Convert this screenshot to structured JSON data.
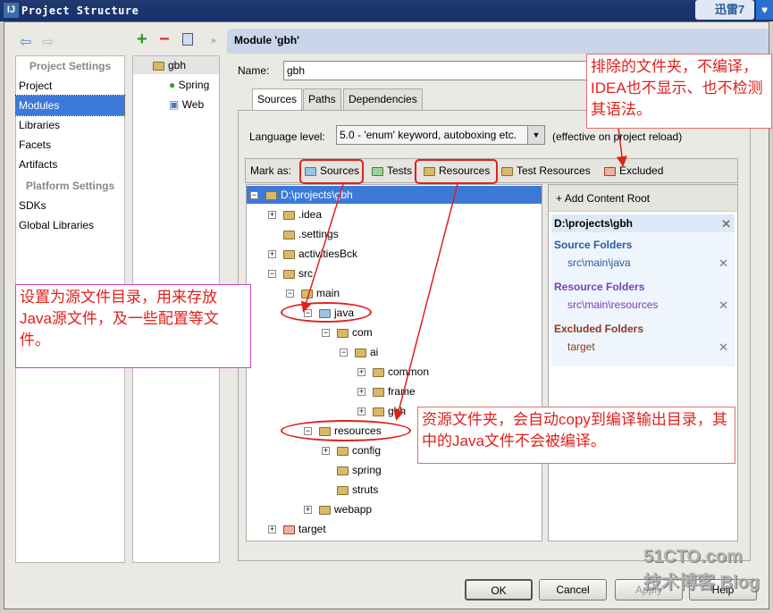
{
  "window": {
    "title": "Project Structure",
    "logo": "IJ",
    "overlay_app": "迅雷7"
  },
  "nav": {
    "project_settings_header": "Project Settings",
    "platform_settings_header": "Platform Settings",
    "items": [
      "Project",
      "Modules",
      "Libraries",
      "Facets",
      "Artifacts"
    ],
    "platform_items": [
      "SDKs",
      "Global Libraries"
    ],
    "selected": "Modules"
  },
  "module_tree": {
    "root": "gbh",
    "children": [
      "Spring",
      "Web"
    ]
  },
  "header": {
    "title": "Module 'gbh'"
  },
  "name_field": {
    "label": "Name:",
    "value": "gbh"
  },
  "tabs": [
    "Sources",
    "Paths",
    "Dependencies"
  ],
  "language": {
    "label": "Language level:",
    "value": "5.0 - 'enum' keyword, autoboxing etc.",
    "note": "(effective on project reload)"
  },
  "mark_as": {
    "label": "Mark as:",
    "items": [
      "Sources",
      "Tests",
      "Resources",
      "Test Resources",
      "Excluded"
    ]
  },
  "tree": [
    {
      "label": "D:\\projects\\gbh",
      "level": 0,
      "exp": "-",
      "sel": true
    },
    {
      "label": ".idea",
      "level": 1,
      "exp": "+"
    },
    {
      "label": ".settings",
      "level": 1
    },
    {
      "label": "activitiesBck",
      "level": 1,
      "exp": "+"
    },
    {
      "label": "src",
      "level": 1,
      "exp": "-"
    },
    {
      "label": "main",
      "level": 2,
      "exp": "-"
    },
    {
      "label": "java",
      "level": 3,
      "exp": "-",
      "kind": "source"
    },
    {
      "label": "com",
      "level": 4,
      "exp": "-"
    },
    {
      "label": "ai",
      "level": 5,
      "exp": "-"
    },
    {
      "label": "common",
      "level": 6,
      "exp": "+"
    },
    {
      "label": "frame",
      "level": 6,
      "exp": "+"
    },
    {
      "label": "gbh",
      "level": 6,
      "exp": "+"
    },
    {
      "label": "resources",
      "level": 3,
      "exp": "-",
      "kind": "resource"
    },
    {
      "label": "config",
      "level": 4,
      "exp": "+"
    },
    {
      "label": "spring",
      "level": 4
    },
    {
      "label": "struts",
      "level": 4
    },
    {
      "label": "webapp",
      "level": 3,
      "exp": "+"
    },
    {
      "label": "target",
      "level": 1,
      "exp": "+",
      "kind": "excluded"
    }
  ],
  "roots": {
    "add_label": "Add Content Root",
    "root": "D:\\projects\\gbh",
    "source_header": "Source Folders",
    "source_path": "src\\main\\java",
    "resource_header": "Resource Folders",
    "resource_path": "src\\main\\resources",
    "excluded_header": "Excluded Folders",
    "excluded_path": "target"
  },
  "buttons": {
    "ok": "OK",
    "cancel": "Cancel",
    "apply": "Apply",
    "help": "Help"
  },
  "annotations": {
    "excluded_note": "排除的文件夹，不编译，IDEA也不显示、也不检测其语法。",
    "source_note": "设置为源文件目录，用来存放Java源文件，及一些配置等文件。",
    "resource_note": "资源文件夹，会自动copy到编译输出目录，其中的Java文件不会被编译。"
  },
  "watermark": "51CTO.com 技术博客 Blog",
  "colors": {
    "selection": "#3d7ad8",
    "annotation": "#e0201c",
    "source": "#2a5c9a",
    "resource": "#7a3fc0",
    "excluded": "#8b3a1a"
  }
}
